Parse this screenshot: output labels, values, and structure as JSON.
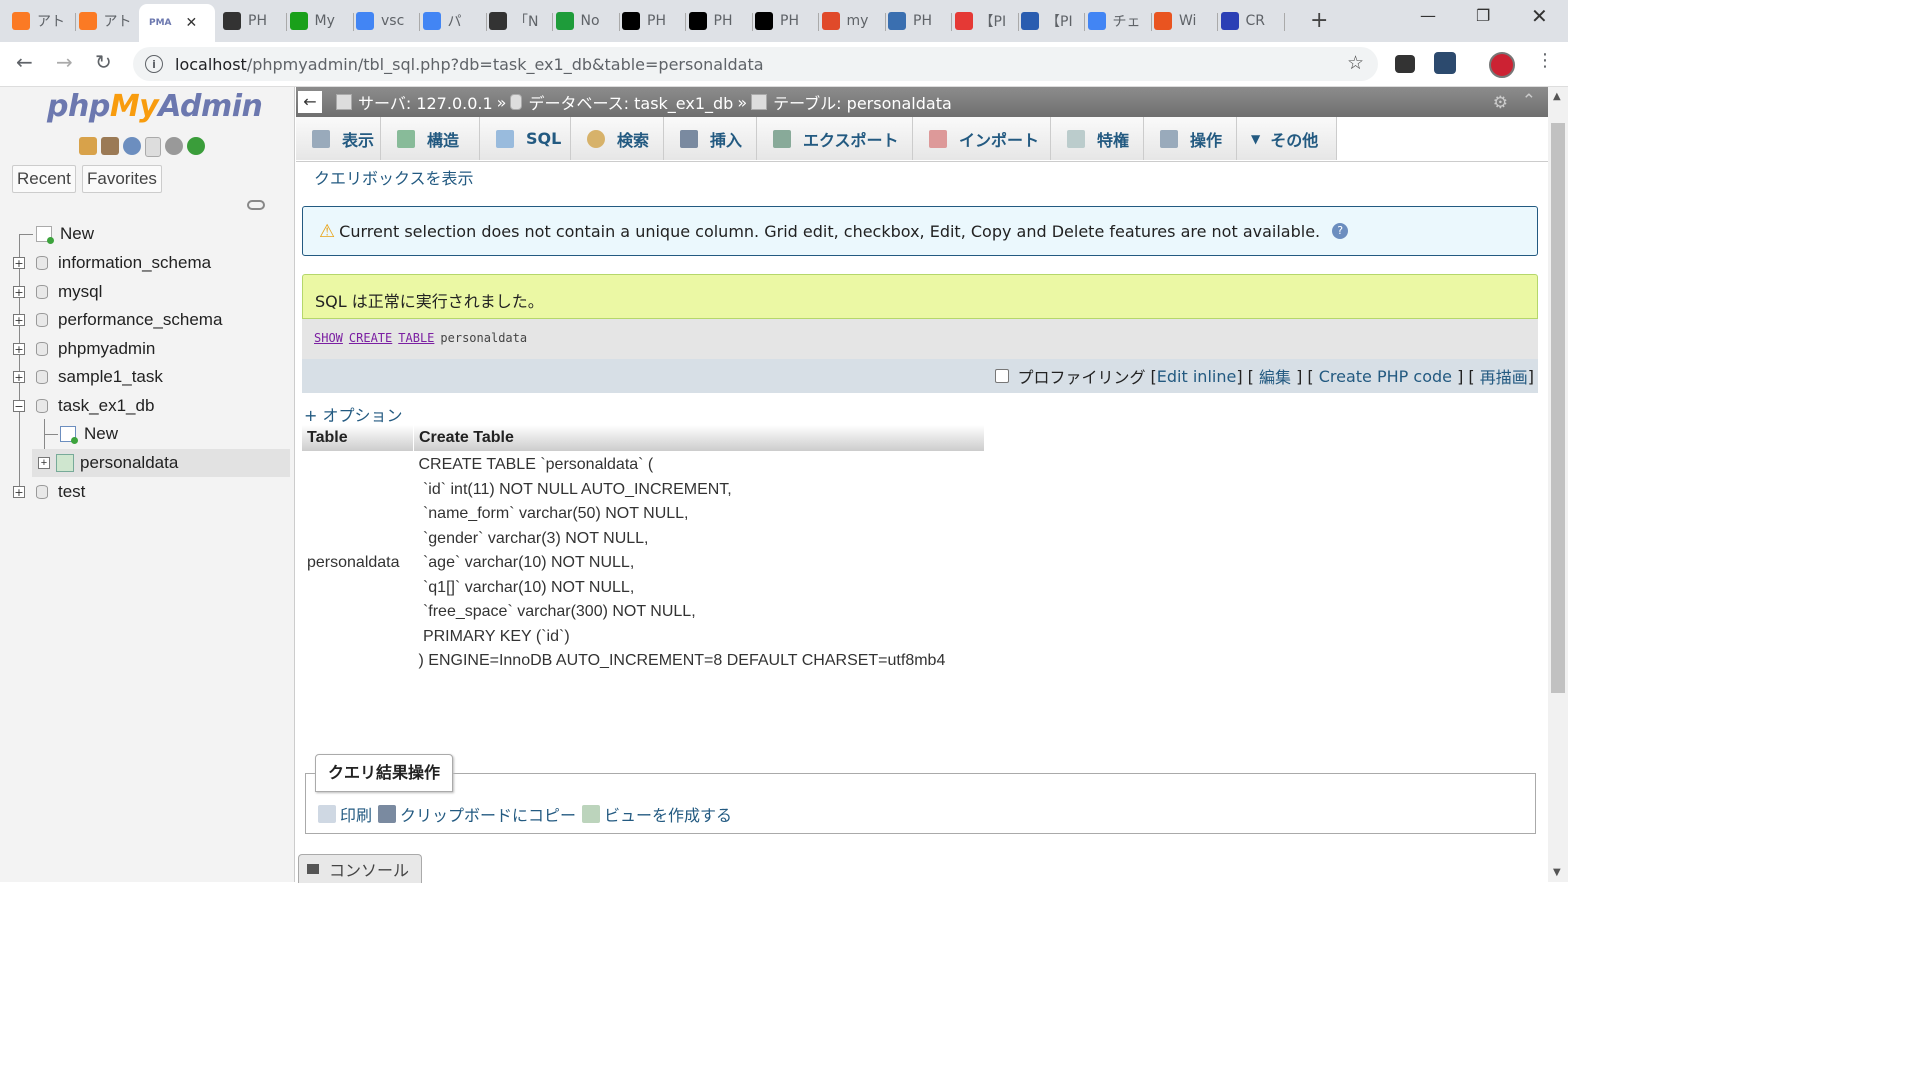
{
  "browser": {
    "tabs": [
      {
        "label": "アト",
        "icon": "xampp-icon",
        "color": "#fb7a24"
      },
      {
        "label": "アト",
        "icon": "xampp-icon",
        "color": "#fb7a24"
      },
      {
        "label": "PMA",
        "icon": "phpmyadmin-icon",
        "color": "#6c78af",
        "active": true
      },
      {
        "label": "PH",
        "icon": "printer-icon",
        "color": "#333333"
      },
      {
        "label": "My",
        "icon": "l-icon",
        "color": "#1aa01a"
      },
      {
        "label": "vsc",
        "icon": "google-icon",
        "color": "#4285f4"
      },
      {
        "label": "パ",
        "icon": "google-icon",
        "color": "#4285f4"
      },
      {
        "label": "「N",
        "icon": "printer-icon",
        "color": "#333333"
      },
      {
        "label": "No",
        "icon": "green-circle-icon",
        "color": "#1e9c3a"
      },
      {
        "label": "PH",
        "icon": "a-icon",
        "color": "#000000"
      },
      {
        "label": "PH",
        "icon": "a-icon",
        "color": "#000000"
      },
      {
        "label": "PH",
        "icon": "a-icon",
        "color": "#000000"
      },
      {
        "label": "my",
        "icon": "stack-icon",
        "color": "#e04a2a"
      },
      {
        "label": "PH",
        "icon": "code-icon",
        "color": "#3a6fb0"
      },
      {
        "label": "【PI",
        "icon": "red-dot-icon",
        "color": "#e53935"
      },
      {
        "label": "【PI",
        "icon": "grid-icon",
        "color": "#2a5db0"
      },
      {
        "label": "チェ",
        "icon": "google-icon",
        "color": "#4285f4"
      },
      {
        "label": "Wi",
        "icon": "ubuntu-icon",
        "color": "#e95420"
      },
      {
        "label": "CR",
        "icon": "w-icon",
        "color": "#2b3fb5"
      }
    ],
    "url_host": "localhost",
    "url_path": "/phpmyadmin/tbl_sql.php?db=task_ex1_db&table=personaldata"
  },
  "nav": {
    "logo_php": "php",
    "logo_my": "My",
    "logo_admin": "Admin",
    "recent": "Recent",
    "favorites": "Favorites",
    "tree": [
      {
        "label": "New"
      },
      {
        "label": "information_schema"
      },
      {
        "label": "mysql"
      },
      {
        "label": "performance_schema"
      },
      {
        "label": "phpmyadmin"
      },
      {
        "label": "sample1_task"
      },
      {
        "label": "task_ex1_db"
      },
      {
        "label": "New"
      },
      {
        "label": "personaldata"
      },
      {
        "label": "test"
      }
    ]
  },
  "breadcrumb": {
    "server": "サーバ: 127.0.0.1",
    "sep": "»",
    "database": "データベース: task_ex1_db",
    "table": "テーブル: personaldata"
  },
  "tabs": [
    "表示",
    "構造",
    "SQL",
    "検索",
    "挿入",
    "エクスポート",
    "インポート",
    "特権",
    "操作",
    "その他"
  ],
  "query_box_link": "クエリボックスを表示",
  "notice": "Current selection does not contain a unique column. Grid edit, checkbox, Edit, Copy and Delete features are not available.",
  "success": "SQL は正常に実行されました。",
  "sql": {
    "kw1": "SHOW",
    "kw2": "CREATE",
    "kw3": "TABLE",
    "name": "personaldata"
  },
  "toolrow": {
    "profiling": "プロファイリング",
    "edit_inline": "Edit inline",
    "edit": "編集",
    "create_php": "Create PHP code",
    "refresh": "再描画"
  },
  "options_link": "+ オプション",
  "result": {
    "headers": [
      "Table",
      "Create Table"
    ],
    "table_name": "personaldata",
    "ddl": "CREATE TABLE `personaldata` (\n `id` int(11) NOT NULL AUTO_INCREMENT,\n `name_form` varchar(50) NOT NULL,\n `gender` varchar(3) NOT NULL,\n `age` varchar(10) NOT NULL,\n `q1[]` varchar(10) NOT NULL,\n `free_space` varchar(300) NOT NULL,\n PRIMARY KEY (`id`)\n) ENGINE=InnoDB AUTO_INCREMENT=8 DEFAULT CHARSET=utf8mb4"
  },
  "query_ops": {
    "legend": "クエリ結果操作",
    "print": "印刷",
    "copy": "クリップボードにコピー",
    "create_view": "ビューを作成する"
  },
  "console": "コンソール"
}
